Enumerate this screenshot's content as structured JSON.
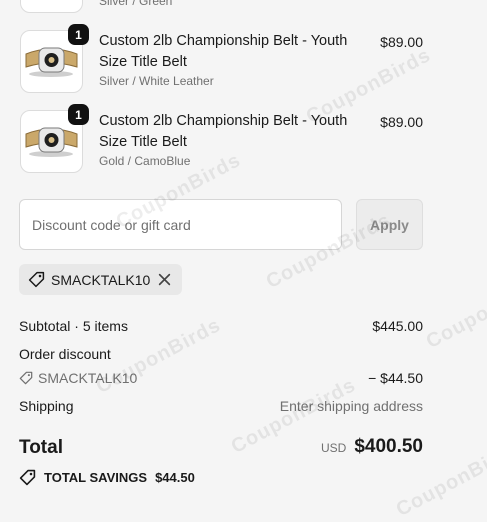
{
  "cart": {
    "items": [
      {
        "title": "",
        "variant": "Silver / Green",
        "price": "",
        "qty": ""
      },
      {
        "title": "Custom 2lb Championship Belt - Youth Size Title Belt",
        "variant": "Silver / White Leather",
        "price": "$89.00",
        "qty": "1"
      },
      {
        "title": "Custom 2lb Championship Belt - Youth Size Title Belt",
        "variant": "Gold / CamoBlue",
        "price": "$89.00",
        "qty": "1"
      }
    ]
  },
  "discount": {
    "placeholder": "Discount code or gift card",
    "apply_label": "Apply",
    "applied_code": "SMACKTALK10"
  },
  "summary": {
    "subtotal_label": "Subtotal · 5 items",
    "subtotal_value": "$445.00",
    "order_discount_label": "Order discount",
    "discount_code": "SMACKTALK10",
    "discount_value": "− $44.50",
    "shipping_label": "Shipping",
    "shipping_value": "Enter shipping address",
    "total_label": "Total",
    "currency": "USD",
    "total_value": "$400.50",
    "savings_label": "TOTAL SAVINGS",
    "savings_value": "$44.50"
  },
  "watermark": "CouponBirds",
  "icons": {
    "tag": "tag-icon",
    "remove": "close-icon"
  }
}
